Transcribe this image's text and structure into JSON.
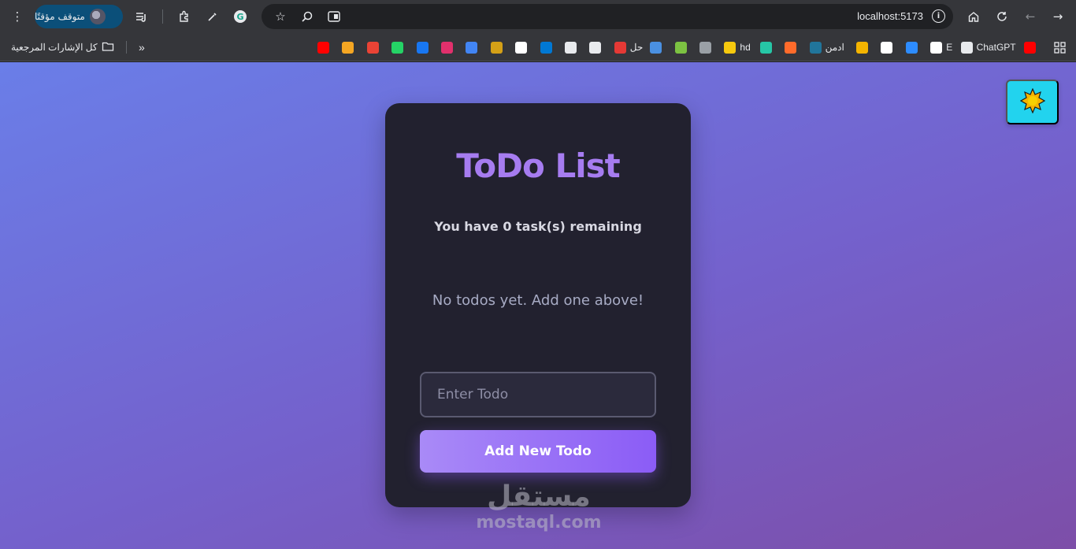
{
  "browser": {
    "profile_label": "متوقف مؤقتًا",
    "url": "localhost:5173"
  },
  "bookmarks": {
    "all_bookmarks_label": "كل الإشارات المرجعية",
    "items": [
      {
        "label": "",
        "icon": "youtube-icon",
        "color": "#ff0000"
      },
      {
        "label": "ChatGPT",
        "icon": "chatgpt-icon",
        "color": "#e8eaed"
      },
      {
        "label": "E",
        "icon": "sc-icon",
        "color": "#ffffff"
      },
      {
        "label": "",
        "icon": "zoom-icon",
        "color": "#2d8cff"
      },
      {
        "label": "",
        "icon": "github-icon",
        "color": "#ffffff"
      },
      {
        "label": "",
        "icon": "image-icon",
        "color": "#f4b400"
      },
      {
        "label": "ادمن",
        "icon": "wordpress-icon",
        "color": "#21759b"
      },
      {
        "label": "",
        "icon": "fire-icon",
        "color": "#ff6b2b"
      },
      {
        "label": "",
        "icon": "z-icon",
        "color": "#26c6a6"
      },
      {
        "label": "hd",
        "icon": "hd-icon",
        "color": "#f6c90e"
      },
      {
        "label": "",
        "icon": "layers-icon",
        "color": "#9aa0a6"
      },
      {
        "label": "",
        "icon": "download-icon",
        "color": "#7cc242"
      },
      {
        "label": "",
        "icon": "cloud-icon",
        "color": "#4a90e2"
      },
      {
        "label": "حل",
        "icon": "ain-icon",
        "color": "#e53935"
      },
      {
        "label": "",
        "icon": "ghost-icon",
        "color": "#e8eaed"
      },
      {
        "label": "",
        "icon": "egy-icon",
        "color": "#e8eaed"
      },
      {
        "label": "",
        "icon": "outlook-icon",
        "color": "#0078d4"
      },
      {
        "label": "",
        "icon": "google-icon",
        "color": "#ffffff"
      },
      {
        "label": "",
        "icon": "coin-icon",
        "color": "#d4a017"
      },
      {
        "label": "",
        "icon": "contacts-icon",
        "color": "#4285f4"
      },
      {
        "label": "",
        "icon": "instagram-icon",
        "color": "#e1306c"
      },
      {
        "label": "",
        "icon": "facebook-icon",
        "color": "#1877f2"
      },
      {
        "label": "",
        "icon": "whatsapp-icon",
        "color": "#25d366"
      },
      {
        "label": "",
        "icon": "gmail-icon",
        "color": "#ea4335"
      },
      {
        "label": "",
        "icon": "in-icon",
        "color": "#f5a623"
      },
      {
        "label": "",
        "icon": "youtube-icon",
        "color": "#ff0000"
      }
    ]
  },
  "app": {
    "title": "ToDo List",
    "remaining_text": "You have 0 task(s) remaining",
    "empty_text": "No todos yet. Add one above!",
    "input_placeholder": "Enter Todo",
    "add_button_label": "Add New Todo",
    "theme_icon": "sun-icon",
    "accent_color": "#a67cf0",
    "card_color": "#22212f",
    "theme_button_color": "#22d3ee"
  },
  "watermark": {
    "arabic": "مستقل",
    "latin": "mostaql.com"
  }
}
